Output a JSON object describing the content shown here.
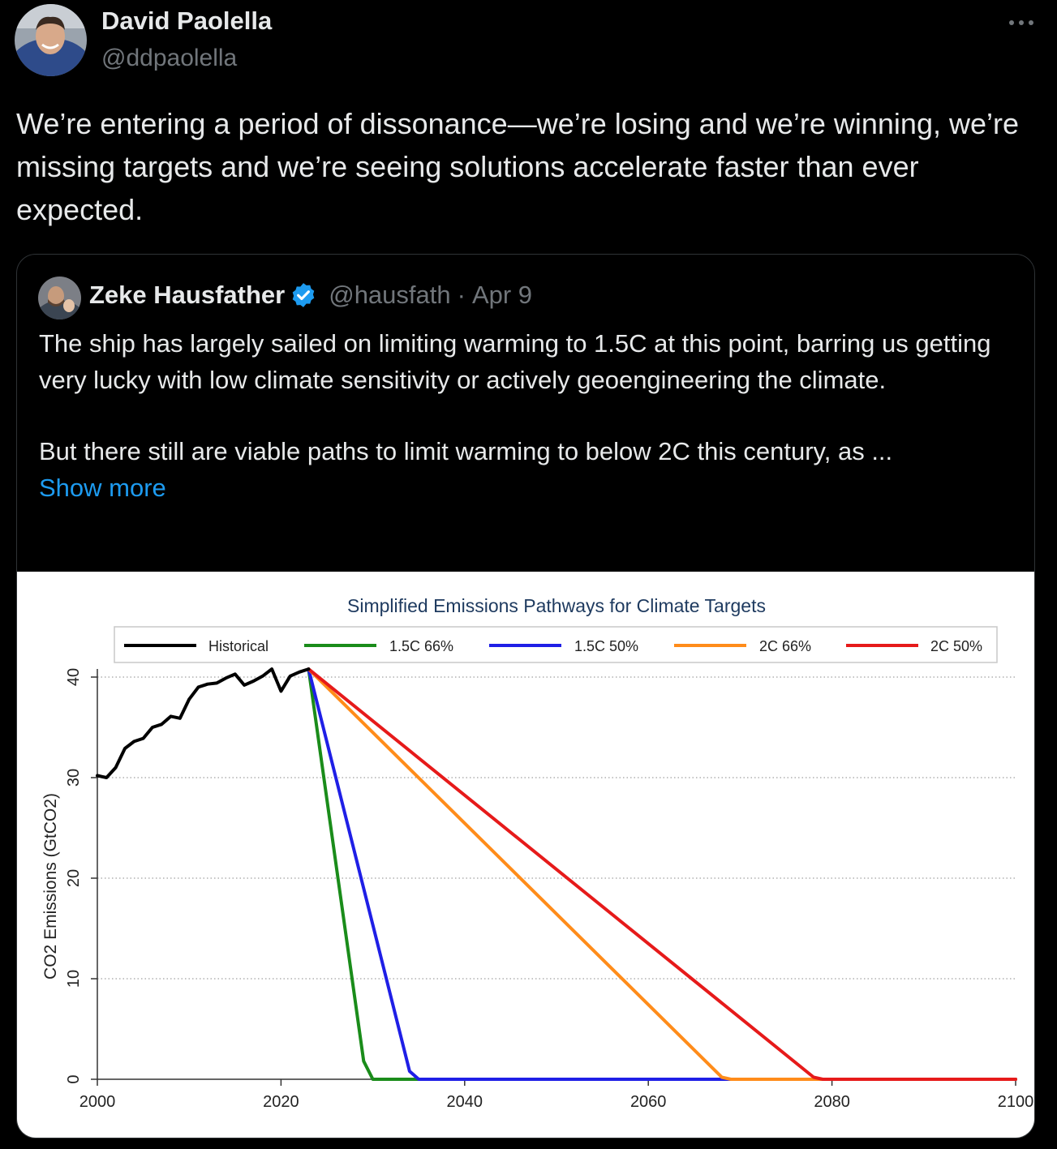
{
  "author": {
    "name": "David Paolella",
    "handle": "@ddpaolella"
  },
  "tweet": {
    "text": "We’re entering a period of dissonance—we’re losing and we’re winning, we’re missing targets and we’re seeing solutions accelerate faster than ever expected."
  },
  "quoted": {
    "name": "Zeke Hausfather",
    "handle": "@hausfath",
    "separator": "·",
    "date": "Apr 9",
    "paragraph1": "The ship has largely sailed on limiting warming to 1.5C at this point, barring us getting very lucky with low climate sensitivity or actively geoengineering the climate.",
    "paragraph2": "But there still are viable paths to limit warming to below 2C this century, as ...",
    "show_more": "Show more"
  },
  "colors": {
    "verified": "#1d9bf0",
    "link": "#1d9bf0"
  },
  "chart_data": {
    "type": "line",
    "title": "Simplified Emissions Pathways for Climate Targets",
    "xlabel": "",
    "ylabel": "CO2 Emissions (GtCO2)",
    "xlim": [
      2000,
      2100
    ],
    "ylim": [
      0,
      40
    ],
    "xticks": [
      2000,
      2020,
      2040,
      2060,
      2080,
      2100
    ],
    "yticks": [
      0,
      10,
      20,
      30,
      40
    ],
    "grid": "horizontal dotted",
    "legend_position": "top",
    "series": [
      {
        "name": "Historical",
        "color": "#000000",
        "x": [
          2000,
          2001,
          2002,
          2003,
          2004,
          2005,
          2006,
          2007,
          2008,
          2009,
          2010,
          2011,
          2012,
          2013,
          2014,
          2015,
          2016,
          2017,
          2018,
          2019,
          2020,
          2021,
          2022,
          2023
        ],
        "y": [
          30.2,
          30.0,
          31.0,
          32.9,
          33.6,
          33.9,
          35.0,
          35.3,
          36.1,
          35.9,
          37.8,
          39.0,
          39.3,
          39.4,
          39.9,
          40.3,
          39.2,
          39.6,
          40.1,
          40.8,
          38.6,
          40.1,
          40.5,
          40.8
        ]
      },
      {
        "name": "1.5C 66%",
        "color": "#1a8c1a",
        "x": [
          2023,
          2029,
          2030,
          2100
        ],
        "y": [
          40.8,
          1.8,
          0,
          0
        ]
      },
      {
        "name": "1.5C 50%",
        "color": "#1f1fe6",
        "x": [
          2023,
          2034,
          2035,
          2100
        ],
        "y": [
          40.8,
          0.8,
          0,
          0
        ]
      },
      {
        "name": "2C 66%",
        "color": "#ff8c1a",
        "x": [
          2023,
          2068,
          2069,
          2100
        ],
        "y": [
          40.8,
          0.2,
          0,
          0
        ]
      },
      {
        "name": "2C 50%",
        "color": "#e61a1a",
        "x": [
          2023,
          2078,
          2079,
          2100
        ],
        "y": [
          40.8,
          0.2,
          0,
          0
        ]
      }
    ]
  }
}
